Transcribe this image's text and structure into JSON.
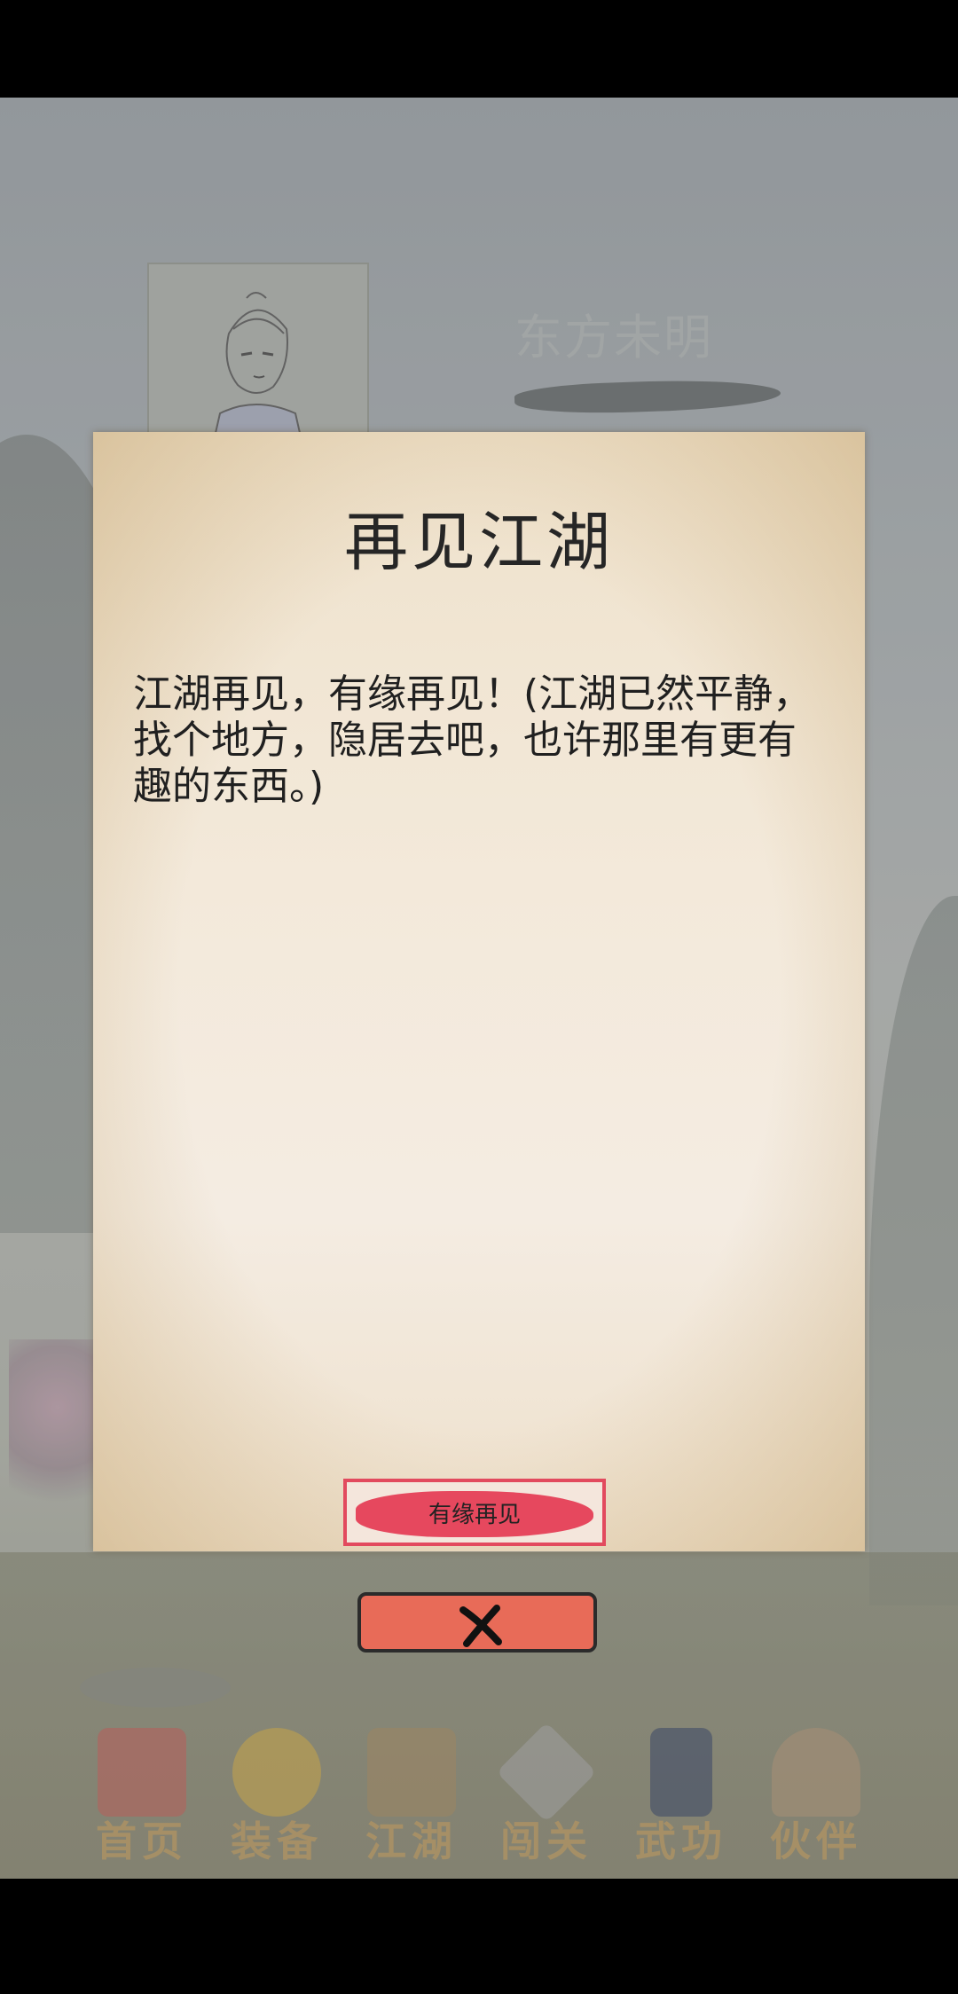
{
  "player": {
    "name": "东方未明"
  },
  "nav": {
    "items": [
      {
        "label": "首页",
        "icon": "temple-icon",
        "color": "#b8544d"
      },
      {
        "label": "装备",
        "icon": "armor-icon",
        "color": "#c8a23a"
      },
      {
        "label": "江湖",
        "icon": "map-icon",
        "color": "#9a7f55"
      },
      {
        "label": "闯关",
        "icon": "swords-icon",
        "color": "#9b9b9b"
      },
      {
        "label": "武功",
        "icon": "book-icon",
        "color": "#2c3a5c"
      },
      {
        "label": "伙伴",
        "icon": "people-icon",
        "color": "#a58a6c"
      }
    ]
  },
  "modal": {
    "title": "再见江湖",
    "message": "江湖再见，有缘再见！(江湖已然平静，找个地方，隐居去吧，也许那里有更有趣的东西。)",
    "confirm_label": "有缘再见"
  },
  "close": {
    "icon": "close-x-icon"
  },
  "colors": {
    "confirm_accent": "#e6485e",
    "close_button": "#e86b58",
    "parchment": "#f3e9da"
  }
}
